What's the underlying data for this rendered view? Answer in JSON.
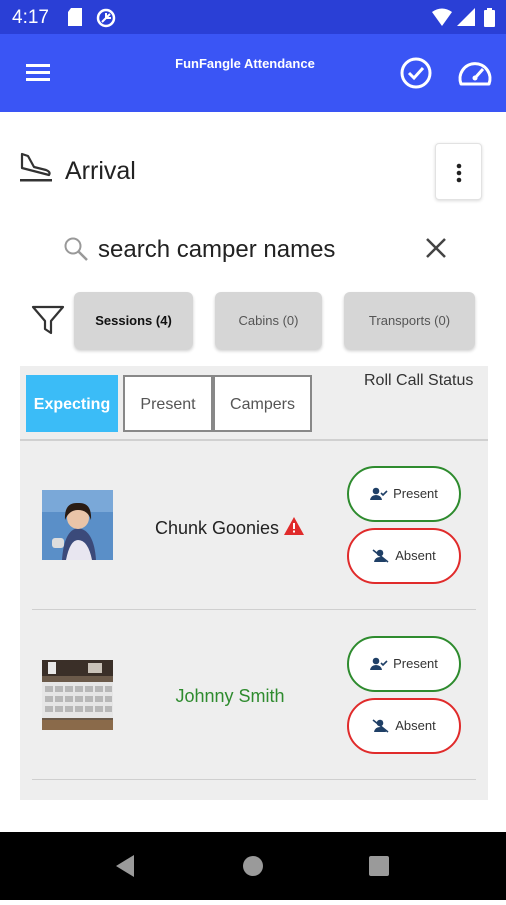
{
  "status_bar": {
    "time": "4:17"
  },
  "app_bar": {
    "title": "FunFangle Attendance"
  },
  "header": {
    "title": "Arrival"
  },
  "search": {
    "placeholder": "search camper names"
  },
  "filters": [
    {
      "label": "Sessions (4)",
      "active": true
    },
    {
      "label": "Cabins (0)",
      "active": false
    },
    {
      "label": "Transports (0)",
      "active": false
    }
  ],
  "tabs": [
    {
      "label": "Expecting",
      "active": true
    },
    {
      "label": "Present",
      "active": false
    },
    {
      "label": "Campers",
      "active": false
    }
  ],
  "roll_call_label": "Roll Call Status",
  "campers": [
    {
      "name": "Chunk Goonies",
      "name_color": "#222222",
      "warning": true,
      "present_label": "Present",
      "absent_label": "Absent"
    },
    {
      "name": "Johnny Smith",
      "name_color": "#2e8b2e",
      "warning": false,
      "present_label": "Present",
      "absent_label": "Absent"
    }
  ],
  "colors": {
    "app_bar": "#3a55f5",
    "tab_active": "#3bbcf7",
    "present": "#2e8b2e",
    "absent": "#e02b2b"
  }
}
